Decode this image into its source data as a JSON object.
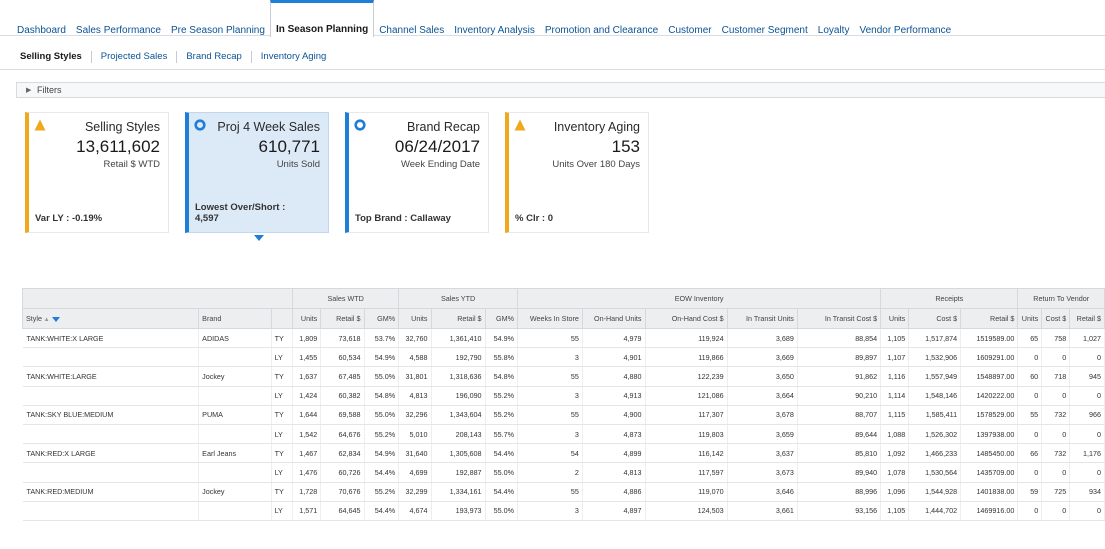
{
  "topnav": [
    "Dashboard",
    "Sales Performance",
    "Pre Season Planning",
    "In Season Planning",
    "Channel Sales",
    "Inventory Analysis",
    "Promotion and Clearance",
    "Customer",
    "Customer Segment",
    "Loyalty",
    "Vendor Performance"
  ],
  "topnav_active": "In Season Planning",
  "subnav": [
    "Selling Styles",
    "Projected Sales",
    "Brand Recap",
    "Inventory Aging"
  ],
  "filters_label": "Filters",
  "tiles": [
    {
      "icon": "warning-icon",
      "title": "Selling Styles",
      "value": "13,611,602",
      "sub": "Retail $ WTD",
      "foot": "Var LY : -0.19%",
      "accent": "#f0a91c"
    },
    {
      "icon": "circle-icon",
      "title": "Proj 4 Week Sales",
      "value": "610,771",
      "sub": "Units Sold",
      "foot": "Lowest Over/Short :\n4,597",
      "accent": "#1f7ed6",
      "selected": true
    },
    {
      "icon": "circle-icon",
      "title": "Brand Recap",
      "value": "06/24/2017",
      "sub": "Week Ending Date",
      "foot": "Top Brand : Callaway",
      "accent": "#1f7ed6"
    },
    {
      "icon": "warning-icon",
      "title": "Inventory Aging",
      "value": "153",
      "sub": "Units Over 180 Days",
      "foot": "% Clr : 0",
      "accent": "#f0a91c"
    }
  ],
  "table": {
    "groups": [
      "Sales WTD",
      "Sales YTD",
      "EOW Inventory",
      "Receipts",
      "Return To Vendor"
    ],
    "columns": [
      "Style",
      "Brand",
      "",
      "Units",
      "Retail $",
      "GM%",
      "Units",
      "Retail $",
      "GM%",
      "Weeks In Store",
      "On-Hand Units",
      "On-Hand Cost $",
      "In Transit Units",
      "In Transit Cost $",
      "Units",
      "Cost $",
      "Retail $",
      "Units",
      "Cost $",
      "Retail $"
    ],
    "rows": [
      [
        "TANK:WHITE:X LARGE",
        "ADIDAS",
        "TY",
        "1,809",
        "73,618",
        "53.7%",
        "32,760",
        "1,361,410",
        "54.9%",
        "55",
        "4,979",
        "119,924",
        "3,689",
        "88,854",
        "1,105",
        "1,517,874",
        "1519589.00",
        "65",
        "758",
        "1,027"
      ],
      [
        "",
        "",
        "LY",
        "1,455",
        "60,534",
        "54.9%",
        "4,588",
        "192,790",
        "55.8%",
        "3",
        "4,901",
        "119,866",
        "3,669",
        "89,897",
        "1,107",
        "1,532,906",
        "1609291.00",
        "0",
        "0",
        "0"
      ],
      [
        "TANK:WHITE:LARGE",
        "Jockey",
        "TY",
        "1,637",
        "67,485",
        "55.0%",
        "31,801",
        "1,318,636",
        "54.8%",
        "55",
        "4,880",
        "122,239",
        "3,650",
        "91,862",
        "1,116",
        "1,557,949",
        "1548897.00",
        "60",
        "718",
        "945"
      ],
      [
        "",
        "",
        "LY",
        "1,424",
        "60,382",
        "54.8%",
        "4,813",
        "196,090",
        "55.2%",
        "3",
        "4,913",
        "121,086",
        "3,664",
        "90,210",
        "1,114",
        "1,548,146",
        "1420222.00",
        "0",
        "0",
        "0"
      ],
      [
        "TANK:SKY BLUE:MEDIUM",
        "PUMA",
        "TY",
        "1,644",
        "69,588",
        "55.0%",
        "32,296",
        "1,343,604",
        "55.2%",
        "55",
        "4,900",
        "117,307",
        "3,678",
        "88,707",
        "1,115",
        "1,585,411",
        "1578529.00",
        "55",
        "732",
        "966"
      ],
      [
        "",
        "",
        "LY",
        "1,542",
        "64,676",
        "55.2%",
        "5,010",
        "208,143",
        "55.7%",
        "3",
        "4,873",
        "119,803",
        "3,659",
        "89,644",
        "1,088",
        "1,526,302",
        "1397938.00",
        "0",
        "0",
        "0"
      ],
      [
        "TANK:RED:X LARGE",
        "Earl Jeans",
        "TY",
        "1,467",
        "62,834",
        "54.9%",
        "31,640",
        "1,305,608",
        "54.4%",
        "54",
        "4,899",
        "116,142",
        "3,637",
        "85,810",
        "1,092",
        "1,466,233",
        "1485450.00",
        "66",
        "732",
        "1,176"
      ],
      [
        "",
        "",
        "LY",
        "1,476",
        "60,726",
        "54.4%",
        "4,699",
        "192,887",
        "55.0%",
        "2",
        "4,813",
        "117,597",
        "3,673",
        "89,940",
        "1,078",
        "1,530,564",
        "1435709.00",
        "0",
        "0",
        "0"
      ],
      [
        "TANK:RED:MEDIUM",
        "Jockey",
        "TY",
        "1,728",
        "70,676",
        "55.2%",
        "32,299",
        "1,334,161",
        "54.4%",
        "55",
        "4,886",
        "119,070",
        "3,646",
        "88,996",
        "1,096",
        "1,544,928",
        "1401838.00",
        "59",
        "725",
        "934"
      ],
      [
        "",
        "",
        "LY",
        "1,571",
        "64,645",
        "54.4%",
        "4,674",
        "193,973",
        "55.0%",
        "3",
        "4,897",
        "124,503",
        "3,661",
        "93,156",
        "1,105",
        "1,444,702",
        "1469916.00",
        "0",
        "0",
        "0"
      ]
    ]
  }
}
